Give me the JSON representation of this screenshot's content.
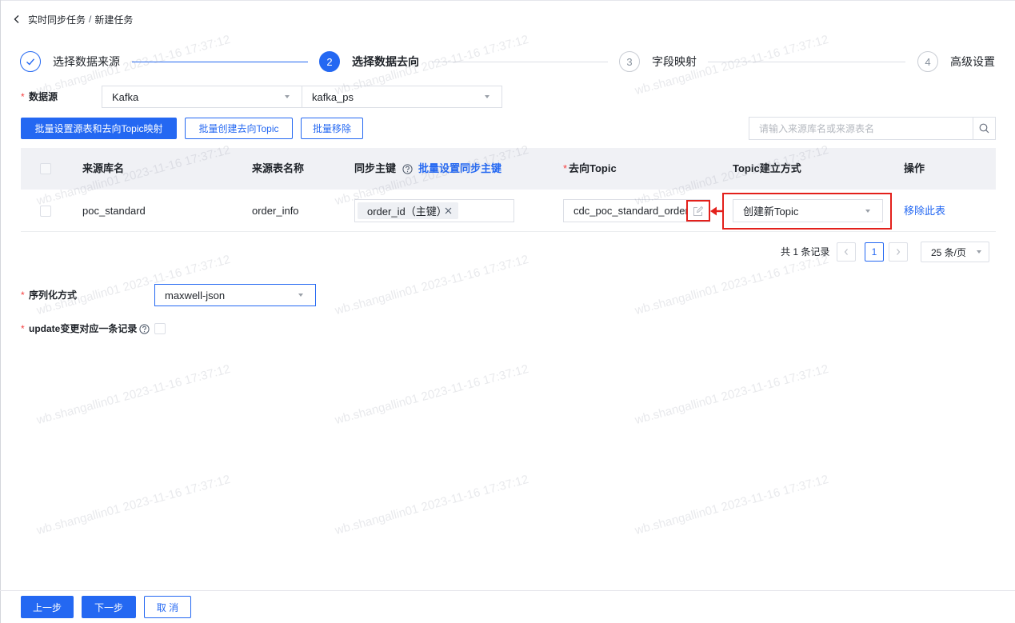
{
  "breadcrumb": {
    "back_icon": "chevron-left-icon",
    "parent": "实时同步任务",
    "separator": "/",
    "current": "新建任务"
  },
  "steps": [
    {
      "icon": "check-icon",
      "label": "选择数据来源",
      "status": "done"
    },
    {
      "index": "2",
      "label": "选择数据去向",
      "status": "active"
    },
    {
      "index": "3",
      "label": "字段映射",
      "status": "pending"
    },
    {
      "index": "4",
      "label": "高级设置",
      "status": "pending"
    }
  ],
  "datasource": {
    "required_mark": "*",
    "label": "数据源",
    "type": {
      "value": "Kafka",
      "icon": "caret-down-icon"
    },
    "instance": {
      "value": "kafka_ps",
      "icon": "caret-down-icon"
    }
  },
  "toolbar": {
    "batch_map_label": "批量设置源表和去向Topic映射",
    "batch_create_label": "批量创建去向Topic",
    "batch_remove_label": "批量移除",
    "search_placeholder": "请输入来源库名或来源表名",
    "search_icon": "search-icon"
  },
  "table": {
    "columns": {
      "source_db": "来源库名",
      "source_table": "来源表名称",
      "sync_key": "同步主键",
      "sync_key_help_icon": "help-icon",
      "batch_sync_key_link": "批量设置同步主键",
      "target_topic_required": "*",
      "target_topic": "去向Topic",
      "topic_mode": "Topic建立方式",
      "actions": "操作"
    },
    "rows": [
      {
        "checked": false,
        "source_db": "poc_standard",
        "source_table": "order_info",
        "sync_key_tag": "order_id（主键）",
        "sync_key_tag_icon": "close-icon",
        "target_topic": "cdc_poc_standard_order_",
        "target_topic_icon": "edit-icon",
        "topic_mode": "创建新Topic",
        "action": "移除此表"
      }
    ]
  },
  "pagination": {
    "total_text": "共 1 条记录",
    "prev_icon": "chevron-left-icon",
    "current_page": "1",
    "next_icon": "chevron-right-icon",
    "page_size": "25 条/页"
  },
  "serialization": {
    "required_mark": "*",
    "label": "序列化方式",
    "value": "maxwell-json"
  },
  "update_option": {
    "required_mark": "*",
    "label": "update变更对应一条记录",
    "help_icon": "help-icon",
    "checked": false
  },
  "footer": {
    "prev_label": "上一步",
    "next_label": "下一步",
    "cancel_label": "取 消"
  },
  "watermark": {
    "text": "wb.shangallin01 2023-11-16 17:37:12"
  },
  "colors": {
    "primary": "#2468f2",
    "required": "#f53f3f",
    "annotation": "#e3201b",
    "table_header_bg": "#f0f1f5"
  }
}
